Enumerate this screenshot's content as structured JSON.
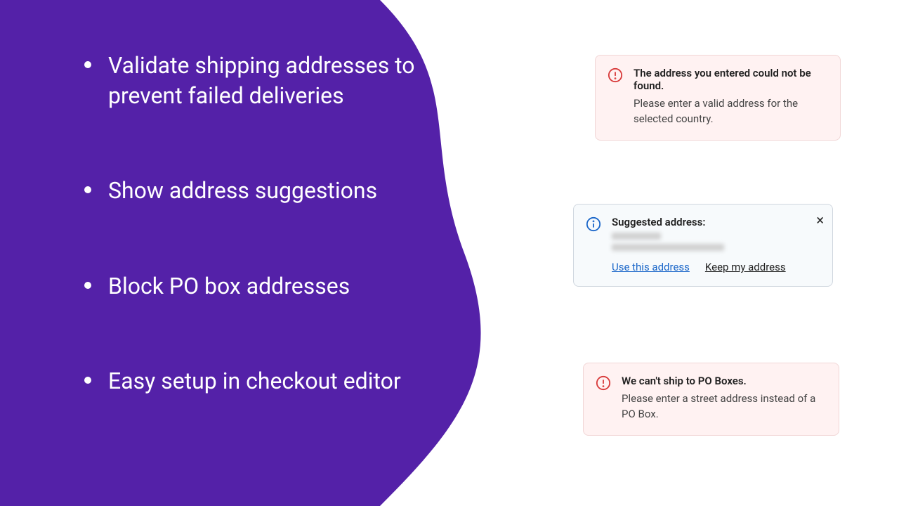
{
  "bullets": {
    "items": [
      "Validate shipping addresses to prevent failed deliveries",
      "Show address suggestions",
      "Block PO box addresses",
      "Easy setup in checkout editor"
    ]
  },
  "cards": {
    "error1": {
      "title": "The address you entered could not be found.",
      "body": "Please enter a valid address for the selected country."
    },
    "suggest": {
      "title": "Suggested address:",
      "action_use": "Use this address",
      "action_keep": "Keep my address"
    },
    "error2": {
      "title": "We can't ship to PO Boxes.",
      "body": "Please enter a street address instead of a PO Box."
    }
  }
}
